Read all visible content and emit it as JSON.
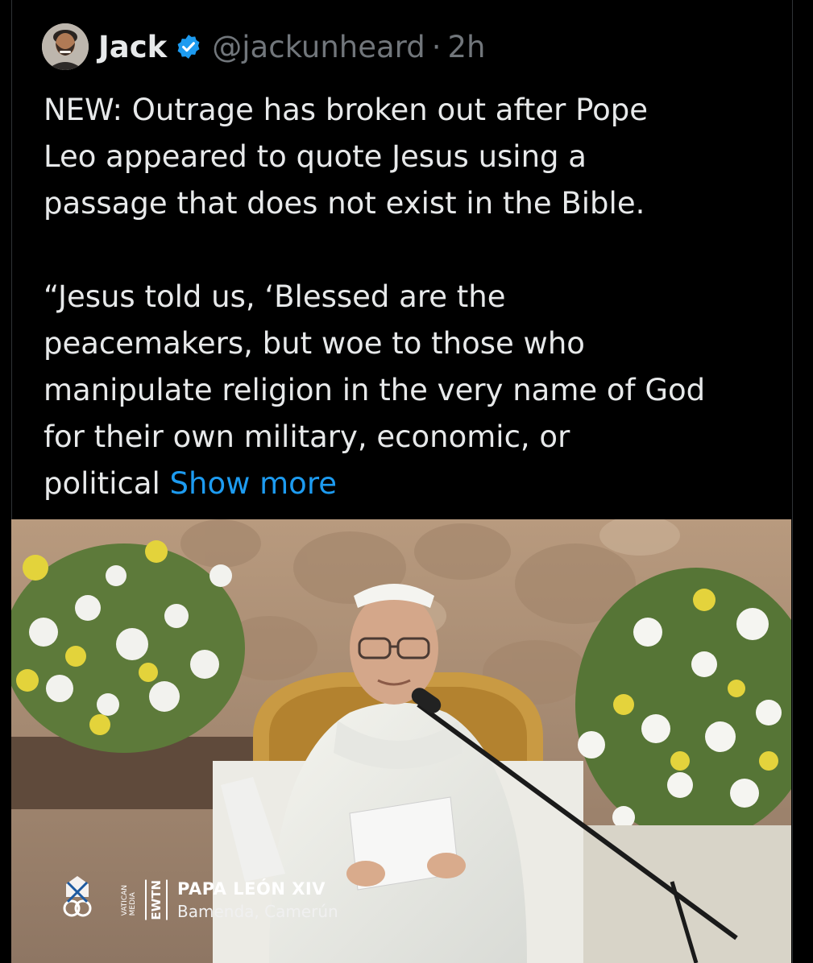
{
  "tweet": {
    "author": {
      "name": "Jack",
      "handle": "@jackunheard",
      "separator": "·",
      "time": "2h",
      "avatar_icon": "user-avatar",
      "verified_icon": "verified-badge-icon"
    },
    "text_lines": [
      "NEW: Outrage has broken out after Pope",
      "Leo appeared to quote Jesus using a",
      "passage that does not exist in the Bible.",
      "“Jesus told us, ‘Blessed are the",
      "peacemakers, but woe to those who",
      "manipulate religion in the very name of God",
      "for their own military, economic, or",
      "political"
    ],
    "show_more": "Show more",
    "media": {
      "overlay": {
        "logo_lines": [
          "VATICAN",
          "MEDIA"
        ],
        "channel": "EWTN",
        "title": "PAPA LEÓN XIV",
        "subtitle": "Bamenda, Camerún"
      }
    }
  },
  "colors": {
    "background": "#000000",
    "text": "#e7e9ea",
    "secondary": "#71767b",
    "link": "#1d9bf0",
    "verified": "#1d9bf0"
  }
}
